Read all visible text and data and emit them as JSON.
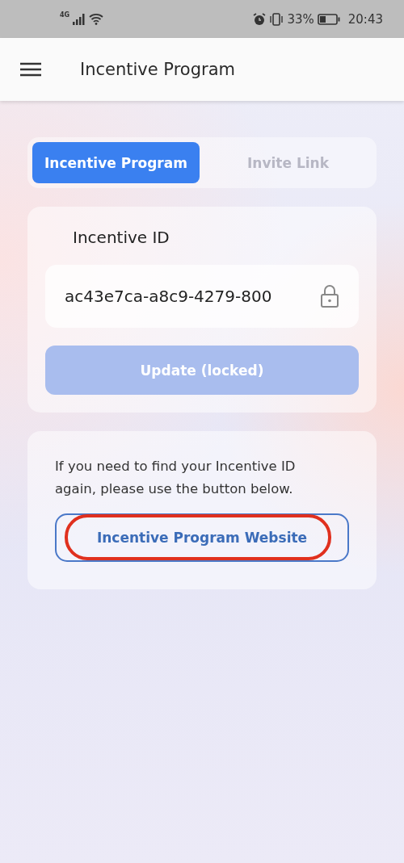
{
  "status_bar": {
    "network": "4G",
    "battery": "33%",
    "time": "20:43"
  },
  "app_bar": {
    "title": "Incentive Program"
  },
  "tabs": [
    {
      "label": "Incentive Program",
      "selected": true
    },
    {
      "label": "Invite Link",
      "selected": false
    }
  ],
  "id_card": {
    "label": "Incentive ID",
    "value": "ac43e7ca-a8c9-4279-800",
    "locked": true,
    "button": {
      "label": "Update (locked)",
      "disabled": true
    }
  },
  "help_card": {
    "text": "If you need to find your Incentive ID again, please use the button below.",
    "button": {
      "label": "Incentive Program Website",
      "circled": true
    }
  }
}
